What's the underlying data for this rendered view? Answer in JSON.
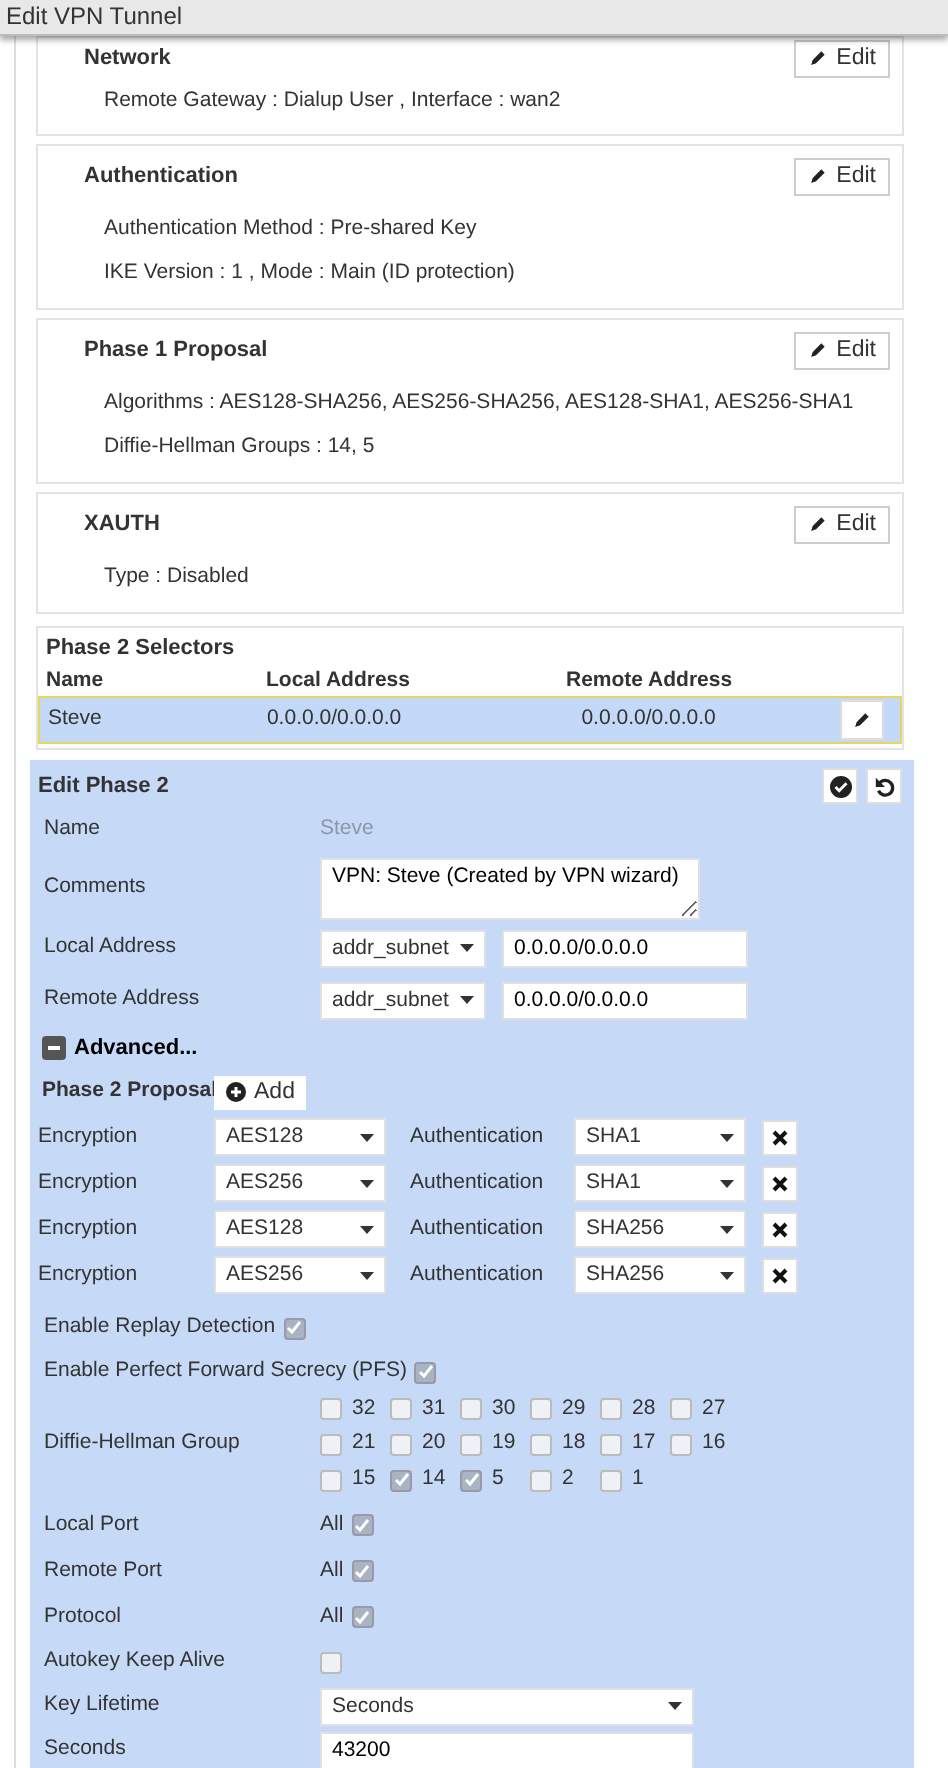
{
  "window": {
    "title": "Edit VPN Tunnel"
  },
  "cards": [
    {
      "title": "Network",
      "edit_label": "Edit",
      "lines": [
        "Remote Gateway : Dialup User , Interface : wan2"
      ]
    },
    {
      "title": "Authentication",
      "edit_label": "Edit",
      "lines": [
        "Authentication Method : Pre-shared Key",
        "IKE Version : 1 , Mode : Main (ID protection)"
      ]
    },
    {
      "title": "Phase 1 Proposal",
      "edit_label": "Edit",
      "lines": [
        "Algorithms : AES128-SHA256, AES256-SHA256, AES128-SHA1, AES256-SHA1",
        "Diffie-Hellman Groups : 14, 5"
      ]
    },
    {
      "title": "XAUTH",
      "edit_label": "Edit",
      "lines": [
        "Type : Disabled"
      ]
    }
  ],
  "selectors": {
    "title": "Phase 2 Selectors",
    "columns": [
      "Name",
      "Local Address",
      "Remote Address"
    ],
    "rows": [
      {
        "cells": [
          "Steve",
          "0.0.0.0/0.0.0.0",
          "0.0.0.0/0.0.0.0"
        ],
        "selected": true
      }
    ]
  },
  "edit_phase2": {
    "title": "Edit Phase 2",
    "name": {
      "label": "Name",
      "value": "Steve"
    },
    "comments": {
      "label": "Comments",
      "value": "VPN: Steve (Created by VPN wizard)"
    },
    "addresses": [
      {
        "label": "Local Address",
        "type": "addr_subnet",
        "value": "0.0.0.0/0.0.0.0"
      },
      {
        "label": "Remote Address",
        "type": "addr_subnet",
        "value": "0.0.0.0/0.0.0.0"
      }
    ],
    "advanced": {
      "label": "Advanced...",
      "expanded": true
    },
    "proposal": {
      "label": "Phase 2 Proposal",
      "add_label": "Add",
      "rows": [
        {
          "enc_label": "Encryption",
          "encryption": "AES128",
          "auth_label": "Authentication",
          "authentication": "SHA1"
        },
        {
          "enc_label": "Encryption",
          "encryption": "AES256",
          "auth_label": "Authentication",
          "authentication": "SHA1"
        },
        {
          "enc_label": "Encryption",
          "encryption": "AES128",
          "auth_label": "Authentication",
          "authentication": "SHA256"
        },
        {
          "enc_label": "Encryption",
          "encryption": "AES256",
          "auth_label": "Authentication",
          "authentication": "SHA256"
        }
      ]
    },
    "settings": [
      {
        "kind": "inline",
        "label": "Enable Replay Detection",
        "checked": true
      },
      {
        "kind": "inline",
        "label": "Enable Perfect Forward Secrecy (PFS)",
        "checked": true
      },
      {
        "kind": "groups",
        "label": "Diffie-Hellman Group",
        "options": [
          {
            "label": "32",
            "checked": false
          },
          {
            "label": "31",
            "checked": false
          },
          {
            "label": "30",
            "checked": false
          },
          {
            "label": "29",
            "checked": false
          },
          {
            "label": "28",
            "checked": false
          },
          {
            "label": "27",
            "checked": false
          },
          {
            "label": "21",
            "checked": false
          },
          {
            "label": "20",
            "checked": false
          },
          {
            "label": "19",
            "checked": false
          },
          {
            "label": "18",
            "checked": false
          },
          {
            "label": "17",
            "checked": false
          },
          {
            "label": "16",
            "checked": false
          },
          {
            "label": "15",
            "checked": false
          },
          {
            "label": "14",
            "checked": true
          },
          {
            "label": "5",
            "checked": true
          },
          {
            "label": "2",
            "checked": false
          },
          {
            "label": "1",
            "checked": false
          }
        ]
      },
      {
        "kind": "all",
        "label": "Local Port",
        "value": "All",
        "checked": true
      },
      {
        "kind": "all",
        "label": "Remote Port",
        "value": "All",
        "checked": true
      },
      {
        "kind": "all",
        "label": "Protocol",
        "value": "All",
        "checked": true
      },
      {
        "kind": "box",
        "label": "Autokey Keep Alive",
        "checked": false
      },
      {
        "kind": "select",
        "label": "Key Lifetime",
        "value": "Seconds"
      },
      {
        "kind": "input",
        "label": "Seconds",
        "value": "43200"
      }
    ]
  }
}
